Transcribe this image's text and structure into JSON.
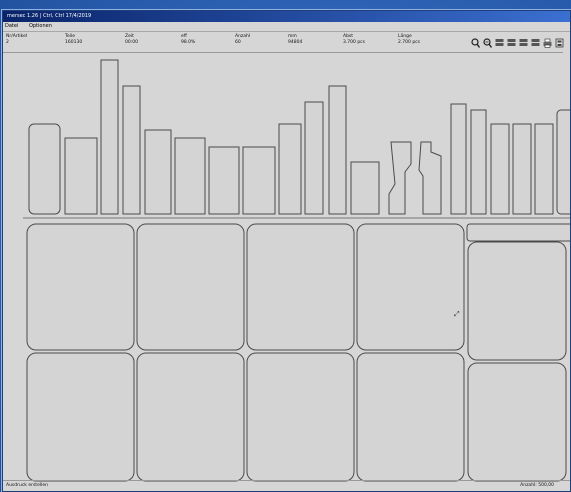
{
  "window": {
    "title": "mersec 1.26 | Ctrl, Ctrl 17/4/2019"
  },
  "menu": [
    "Datei",
    "Optionen"
  ],
  "info": [
    {
      "label": "Nr/Artikel",
      "value": "2"
    },
    {
      "label": "Teile",
      "value": "160130"
    },
    {
      "label": "Zeit",
      "value": "00:00"
    },
    {
      "label": "eff",
      "value": "98.0%"
    },
    {
      "label": "Anzahl",
      "value": "60"
    },
    {
      "label": "mm",
      "value": "94804"
    },
    {
      "label": "Abst",
      "value": "3.700 pcs"
    },
    {
      "label": "Länge",
      "value": "2.700 pcs"
    }
  ],
  "toolbar": {
    "tools": [
      "zoom-in-icon",
      "zoom-out-icon",
      "layout-a-icon",
      "layout-b-icon",
      "layout-c-icon",
      "layout-d-icon",
      "print-icon",
      "export-icon"
    ]
  },
  "cursor_label": "⤢",
  "status": {
    "left": "Ausdruck erstellen",
    "right": "Anzahl: 500,00"
  },
  "colors": {
    "desktop": "#2d62b4",
    "panel": "#d6d6d6",
    "stroke": "#4a4a4a"
  }
}
